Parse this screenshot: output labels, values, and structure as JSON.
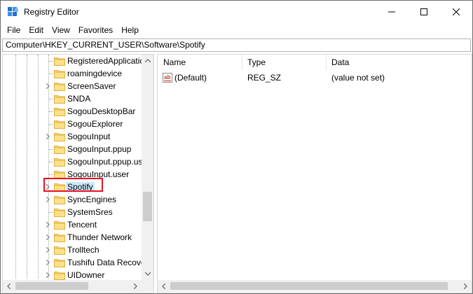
{
  "window": {
    "title": "Registry Editor",
    "accent_color": "#0078d7"
  },
  "menu": {
    "items": [
      "File",
      "Edit",
      "View",
      "Favorites",
      "Help"
    ]
  },
  "address": {
    "path": "Computer\\HKEY_CURRENT_USER\\Software\\Spotify"
  },
  "tree": {
    "items": [
      {
        "label": "RegisteredApplicatic",
        "expandable": false
      },
      {
        "label": "roamingdevice",
        "expandable": false
      },
      {
        "label": "ScreenSaver",
        "expandable": true
      },
      {
        "label": "SNDA",
        "expandable": false
      },
      {
        "label": "SogouDesktopBar",
        "expandable": false
      },
      {
        "label": "SogouExplorer",
        "expandable": false
      },
      {
        "label": "SogouInput",
        "expandable": true
      },
      {
        "label": "SogouInput.ppup",
        "expandable": false
      },
      {
        "label": "SogouInput.ppup.us",
        "expandable": false
      },
      {
        "label": "SogouInput.user",
        "expandable": false
      },
      {
        "label": "Spotify",
        "expandable": true,
        "selected": true
      },
      {
        "label": "SyncEngines",
        "expandable": true
      },
      {
        "label": "SystemSres",
        "expandable": false
      },
      {
        "label": "Tencent",
        "expandable": true
      },
      {
        "label": "Thunder Network",
        "expandable": true
      },
      {
        "label": "Trolltech",
        "expandable": true
      },
      {
        "label": "Tushifu Data Recove",
        "expandable": true
      },
      {
        "label": "UIDowner",
        "expandable": true
      }
    ],
    "selected_color": "#cce8ff",
    "highlight_color": "#e81123"
  },
  "list": {
    "columns": {
      "name": "Name",
      "type": "Type",
      "data": "Data"
    },
    "rows": [
      {
        "name": "(Default)",
        "type": "REG_SZ",
        "data": "(value not set)",
        "icon": "string-value-icon"
      }
    ]
  }
}
